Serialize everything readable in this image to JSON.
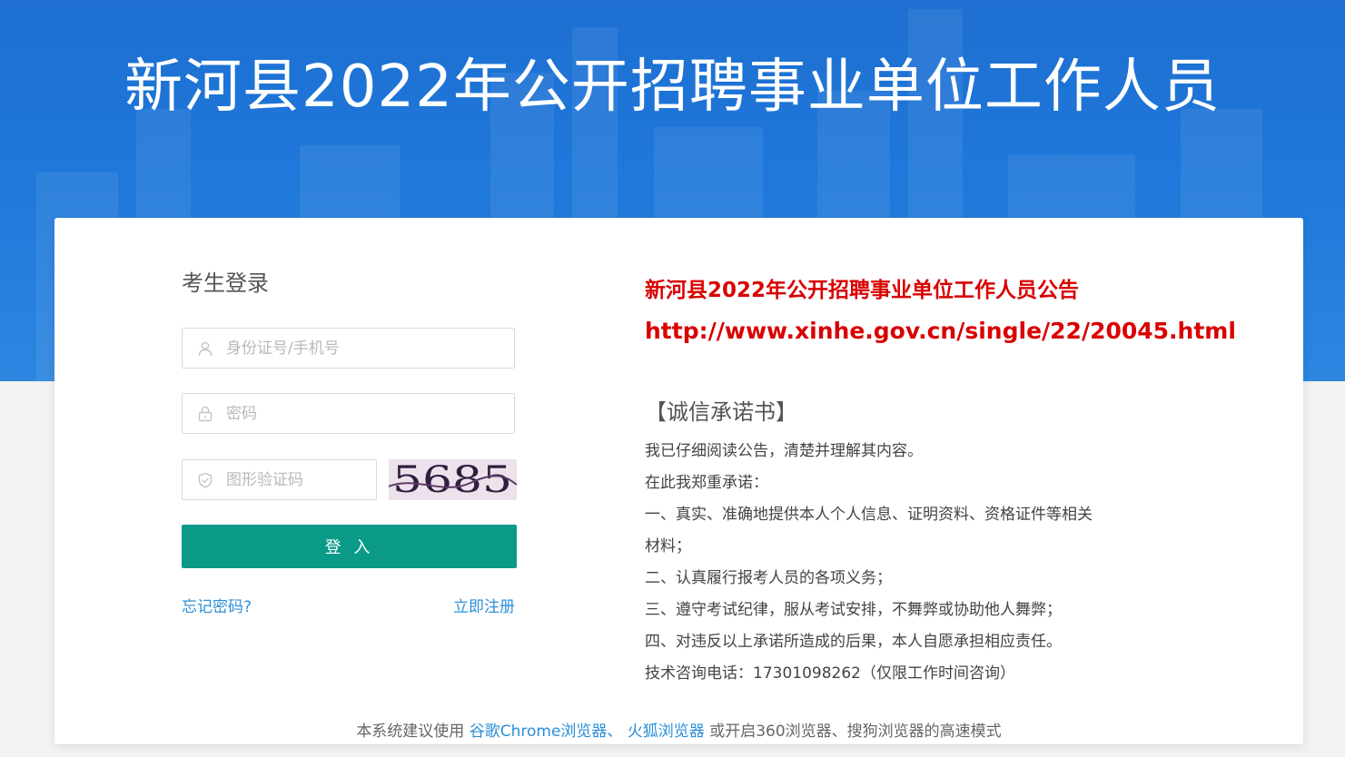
{
  "header": {
    "title": "新河县2022年公开招聘事业单位工作人员"
  },
  "login": {
    "title": "考生登录",
    "id_placeholder": "身份证号/手机号",
    "password_placeholder": "密码",
    "captcha_placeholder": "图形验证码",
    "captcha_text": "5685",
    "login_button": "登 入",
    "forgot_link": "忘记密码?",
    "register_link": "立即注册"
  },
  "notice": {
    "title": "新河县2022年公开招聘事业单位工作人员公告",
    "url": "http://www.xinhe.gov.cn/single/22/20045.html",
    "pledge_title": "【诚信承诺书】",
    "pledge_lines": [
      "我已仔细阅读公告，清楚并理解其内容。",
      "在此我郑重承诺：",
      "一、真实、准确地提供本人个人信息、证明资料、资格证件等相关",
      "材料；",
      "二、认真履行报考人员的各项义务；",
      "三、遵守考试纪律，服从考试安排，不舞弊或协助他人舞弊；",
      "四、对违反以上承诺所造成的后果，本人自愿承担相应责任。",
      "技术咨询电话：17301098262（仅限工作时间咨询）"
    ]
  },
  "footer": {
    "prefix": "本系统建议使用",
    "chrome_link": "谷歌Chrome浏览器、",
    "firefox_link": "火狐浏览器",
    "suffix": "或开启360浏览器、搜狗浏览器的高速模式"
  },
  "colors": {
    "banner": "#1f78da",
    "button": "#0a9a87",
    "link": "#2b8fd8",
    "notice": "#d90000"
  },
  "icons": [
    "user-icon",
    "lock-icon",
    "shield-icon"
  ]
}
